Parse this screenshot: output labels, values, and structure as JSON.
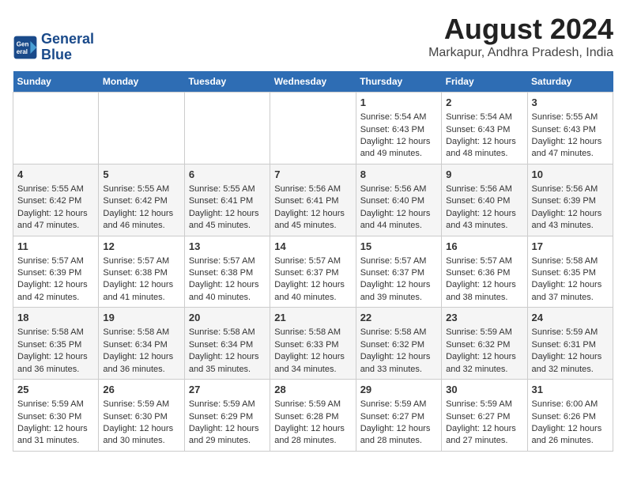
{
  "header": {
    "logo_line1": "General",
    "logo_line2": "Blue",
    "title": "August 2024",
    "subtitle": "Markapur, Andhra Pradesh, India"
  },
  "days_of_week": [
    "Sunday",
    "Monday",
    "Tuesday",
    "Wednesday",
    "Thursday",
    "Friday",
    "Saturday"
  ],
  "weeks": [
    [
      {
        "day": "",
        "info": ""
      },
      {
        "day": "",
        "info": ""
      },
      {
        "day": "",
        "info": ""
      },
      {
        "day": "",
        "info": ""
      },
      {
        "day": "1",
        "info": "Sunrise: 5:54 AM\nSunset: 6:43 PM\nDaylight: 12 hours\nand 49 minutes."
      },
      {
        "day": "2",
        "info": "Sunrise: 5:54 AM\nSunset: 6:43 PM\nDaylight: 12 hours\nand 48 minutes."
      },
      {
        "day": "3",
        "info": "Sunrise: 5:55 AM\nSunset: 6:43 PM\nDaylight: 12 hours\nand 47 minutes."
      }
    ],
    [
      {
        "day": "4",
        "info": "Sunrise: 5:55 AM\nSunset: 6:42 PM\nDaylight: 12 hours\nand 47 minutes."
      },
      {
        "day": "5",
        "info": "Sunrise: 5:55 AM\nSunset: 6:42 PM\nDaylight: 12 hours\nand 46 minutes."
      },
      {
        "day": "6",
        "info": "Sunrise: 5:55 AM\nSunset: 6:41 PM\nDaylight: 12 hours\nand 45 minutes."
      },
      {
        "day": "7",
        "info": "Sunrise: 5:56 AM\nSunset: 6:41 PM\nDaylight: 12 hours\nand 45 minutes."
      },
      {
        "day": "8",
        "info": "Sunrise: 5:56 AM\nSunset: 6:40 PM\nDaylight: 12 hours\nand 44 minutes."
      },
      {
        "day": "9",
        "info": "Sunrise: 5:56 AM\nSunset: 6:40 PM\nDaylight: 12 hours\nand 43 minutes."
      },
      {
        "day": "10",
        "info": "Sunrise: 5:56 AM\nSunset: 6:39 PM\nDaylight: 12 hours\nand 43 minutes."
      }
    ],
    [
      {
        "day": "11",
        "info": "Sunrise: 5:57 AM\nSunset: 6:39 PM\nDaylight: 12 hours\nand 42 minutes."
      },
      {
        "day": "12",
        "info": "Sunrise: 5:57 AM\nSunset: 6:38 PM\nDaylight: 12 hours\nand 41 minutes."
      },
      {
        "day": "13",
        "info": "Sunrise: 5:57 AM\nSunset: 6:38 PM\nDaylight: 12 hours\nand 40 minutes."
      },
      {
        "day": "14",
        "info": "Sunrise: 5:57 AM\nSunset: 6:37 PM\nDaylight: 12 hours\nand 40 minutes."
      },
      {
        "day": "15",
        "info": "Sunrise: 5:57 AM\nSunset: 6:37 PM\nDaylight: 12 hours\nand 39 minutes."
      },
      {
        "day": "16",
        "info": "Sunrise: 5:57 AM\nSunset: 6:36 PM\nDaylight: 12 hours\nand 38 minutes."
      },
      {
        "day": "17",
        "info": "Sunrise: 5:58 AM\nSunset: 6:35 PM\nDaylight: 12 hours\nand 37 minutes."
      }
    ],
    [
      {
        "day": "18",
        "info": "Sunrise: 5:58 AM\nSunset: 6:35 PM\nDaylight: 12 hours\nand 36 minutes."
      },
      {
        "day": "19",
        "info": "Sunrise: 5:58 AM\nSunset: 6:34 PM\nDaylight: 12 hours\nand 36 minutes."
      },
      {
        "day": "20",
        "info": "Sunrise: 5:58 AM\nSunset: 6:34 PM\nDaylight: 12 hours\nand 35 minutes."
      },
      {
        "day": "21",
        "info": "Sunrise: 5:58 AM\nSunset: 6:33 PM\nDaylight: 12 hours\nand 34 minutes."
      },
      {
        "day": "22",
        "info": "Sunrise: 5:58 AM\nSunset: 6:32 PM\nDaylight: 12 hours\nand 33 minutes."
      },
      {
        "day": "23",
        "info": "Sunrise: 5:59 AM\nSunset: 6:32 PM\nDaylight: 12 hours\nand 32 minutes."
      },
      {
        "day": "24",
        "info": "Sunrise: 5:59 AM\nSunset: 6:31 PM\nDaylight: 12 hours\nand 32 minutes."
      }
    ],
    [
      {
        "day": "25",
        "info": "Sunrise: 5:59 AM\nSunset: 6:30 PM\nDaylight: 12 hours\nand 31 minutes."
      },
      {
        "day": "26",
        "info": "Sunrise: 5:59 AM\nSunset: 6:30 PM\nDaylight: 12 hours\nand 30 minutes."
      },
      {
        "day": "27",
        "info": "Sunrise: 5:59 AM\nSunset: 6:29 PM\nDaylight: 12 hours\nand 29 minutes."
      },
      {
        "day": "28",
        "info": "Sunrise: 5:59 AM\nSunset: 6:28 PM\nDaylight: 12 hours\nand 28 minutes."
      },
      {
        "day": "29",
        "info": "Sunrise: 5:59 AM\nSunset: 6:27 PM\nDaylight: 12 hours\nand 28 minutes."
      },
      {
        "day": "30",
        "info": "Sunrise: 5:59 AM\nSunset: 6:27 PM\nDaylight: 12 hours\nand 27 minutes."
      },
      {
        "day": "31",
        "info": "Sunrise: 6:00 AM\nSunset: 6:26 PM\nDaylight: 12 hours\nand 26 minutes."
      }
    ]
  ]
}
